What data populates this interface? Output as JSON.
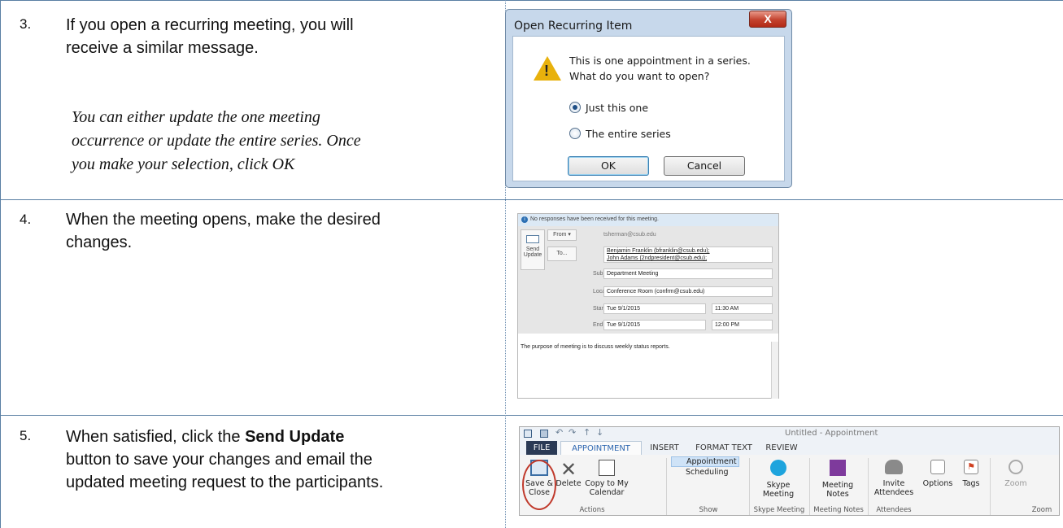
{
  "steps": [
    {
      "number": "3.",
      "line1": "If you open a recurring meeting, you will",
      "line2": "receive a similar message.",
      "note_lines": [
        "You can either update the one meeting",
        "occurrence or update the entire series.  Once",
        "you make your selection, click OK"
      ]
    },
    {
      "number": "4.",
      "line1": "When the meeting opens, make the desired",
      "line2": "changes."
    },
    {
      "number": "5.",
      "line1_pre": "When satisfied, click the ",
      "line1_bold": "Send Update",
      "line2": "button to save your changes and email the",
      "line3": "updated meeting request to the participants."
    }
  ],
  "dialog": {
    "title": "Open Recurring Item",
    "close": "X",
    "message_line1": "This is one appointment in a series.",
    "message_line2": "What do you want to open?",
    "option1": "Just this one",
    "option2": "The entire series",
    "selected": "option1",
    "ok": "OK",
    "cancel": "Cancel"
  },
  "meeting_form": {
    "info": "No responses have been received for this meeting.",
    "from_button": "From ▾",
    "from_value": "tsherman@csub.edu",
    "send_label1": "Send",
    "send_label2": "Update",
    "to_button": "To...",
    "to_line1": "Benjamin Franklin (bfranklin@csub.edu);",
    "to_line2": "John Adams (2ndpresident@csub.edu);",
    "subject_label": "Subject",
    "subject": "Department Meeting",
    "location_label": "Location",
    "location": "Conference Room (confrm@csub.edu)",
    "start_label": "Start time",
    "start_date": "Tue 9/1/2015",
    "start_time": "11:30 AM",
    "end_label": "End time",
    "end_date": "Tue 9/1/2015",
    "end_time": "12:00 PM",
    "body": "The purpose of meeting is to discuss weekly status reports."
  },
  "ribbon": {
    "window_title": "Untitled - Appointment",
    "tabs": [
      "FILE",
      "APPOINTMENT",
      "INSERT",
      "FORMAT TEXT",
      "REVIEW"
    ],
    "active_tab": "APPOINTMENT",
    "save_close": [
      "Save &",
      "Close"
    ],
    "delete": "Delete",
    "copy_to_calendar": [
      "Copy to My",
      "Calendar"
    ],
    "appointment": "Appointment",
    "scheduling": "Scheduling",
    "skype": [
      "Skype",
      "Meeting"
    ],
    "meeting_notes": [
      "Meeting",
      "Notes"
    ],
    "invite": [
      "Invite",
      "Attendees"
    ],
    "options": "Options",
    "tags": "Tags",
    "zoom": "Zoom",
    "groups": [
      "Actions",
      "Show",
      "Skype Meeting",
      "Meeting Notes",
      "Attendees",
      "Zoom"
    ]
  }
}
